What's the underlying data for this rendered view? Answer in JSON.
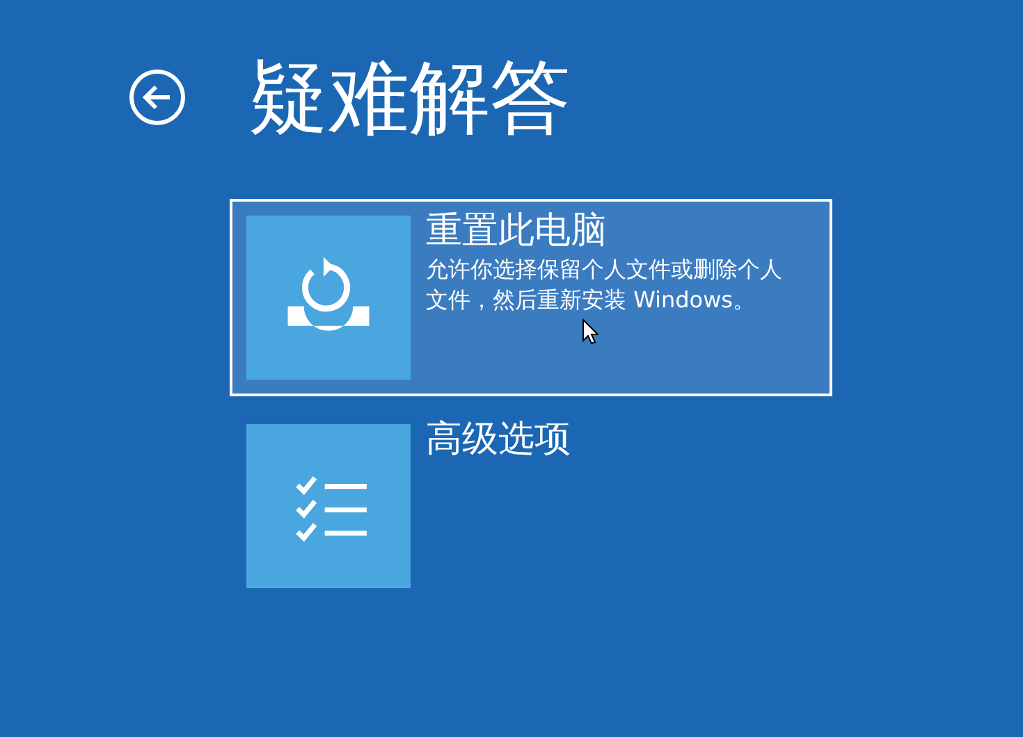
{
  "header": {
    "title": "疑难解答"
  },
  "options": [
    {
      "kind": "reset",
      "title": "重置此电脑",
      "description": "允许你选择保留个人文件或删除个人文件，然后重新安装 Windows。",
      "selected": true
    },
    {
      "kind": "list",
      "title": "高级选项",
      "selected": false
    }
  ]
}
